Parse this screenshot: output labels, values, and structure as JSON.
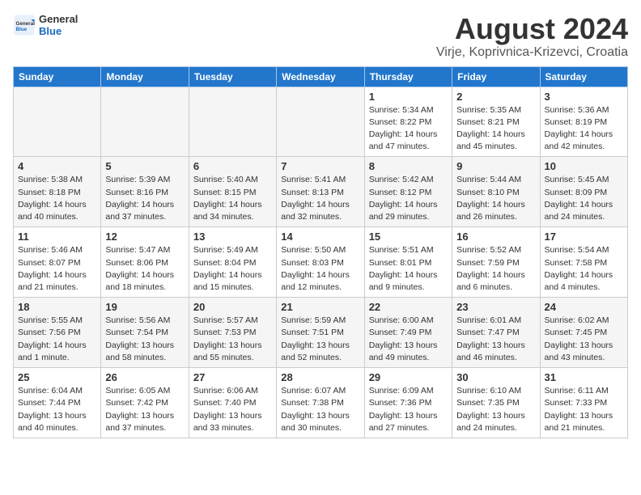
{
  "header": {
    "logo_line1": "General",
    "logo_line2": "Blue",
    "title": "August 2024",
    "subtitle": "Virje, Koprivnica-Krizevci, Croatia"
  },
  "weekdays": [
    "Sunday",
    "Monday",
    "Tuesday",
    "Wednesday",
    "Thursday",
    "Friday",
    "Saturday"
  ],
  "weeks": [
    [
      {
        "day": "",
        "info": ""
      },
      {
        "day": "",
        "info": ""
      },
      {
        "day": "",
        "info": ""
      },
      {
        "day": "",
        "info": ""
      },
      {
        "day": "1",
        "info": "Sunrise: 5:34 AM\nSunset: 8:22 PM\nDaylight: 14 hours\nand 47 minutes."
      },
      {
        "day": "2",
        "info": "Sunrise: 5:35 AM\nSunset: 8:21 PM\nDaylight: 14 hours\nand 45 minutes."
      },
      {
        "day": "3",
        "info": "Sunrise: 5:36 AM\nSunset: 8:19 PM\nDaylight: 14 hours\nand 42 minutes."
      }
    ],
    [
      {
        "day": "4",
        "info": "Sunrise: 5:38 AM\nSunset: 8:18 PM\nDaylight: 14 hours\nand 40 minutes."
      },
      {
        "day": "5",
        "info": "Sunrise: 5:39 AM\nSunset: 8:16 PM\nDaylight: 14 hours\nand 37 minutes."
      },
      {
        "day": "6",
        "info": "Sunrise: 5:40 AM\nSunset: 8:15 PM\nDaylight: 14 hours\nand 34 minutes."
      },
      {
        "day": "7",
        "info": "Sunrise: 5:41 AM\nSunset: 8:13 PM\nDaylight: 14 hours\nand 32 minutes."
      },
      {
        "day": "8",
        "info": "Sunrise: 5:42 AM\nSunset: 8:12 PM\nDaylight: 14 hours\nand 29 minutes."
      },
      {
        "day": "9",
        "info": "Sunrise: 5:44 AM\nSunset: 8:10 PM\nDaylight: 14 hours\nand 26 minutes."
      },
      {
        "day": "10",
        "info": "Sunrise: 5:45 AM\nSunset: 8:09 PM\nDaylight: 14 hours\nand 24 minutes."
      }
    ],
    [
      {
        "day": "11",
        "info": "Sunrise: 5:46 AM\nSunset: 8:07 PM\nDaylight: 14 hours\nand 21 minutes."
      },
      {
        "day": "12",
        "info": "Sunrise: 5:47 AM\nSunset: 8:06 PM\nDaylight: 14 hours\nand 18 minutes."
      },
      {
        "day": "13",
        "info": "Sunrise: 5:49 AM\nSunset: 8:04 PM\nDaylight: 14 hours\nand 15 minutes."
      },
      {
        "day": "14",
        "info": "Sunrise: 5:50 AM\nSunset: 8:03 PM\nDaylight: 14 hours\nand 12 minutes."
      },
      {
        "day": "15",
        "info": "Sunrise: 5:51 AM\nSunset: 8:01 PM\nDaylight: 14 hours\nand 9 minutes."
      },
      {
        "day": "16",
        "info": "Sunrise: 5:52 AM\nSunset: 7:59 PM\nDaylight: 14 hours\nand 6 minutes."
      },
      {
        "day": "17",
        "info": "Sunrise: 5:54 AM\nSunset: 7:58 PM\nDaylight: 14 hours\nand 4 minutes."
      }
    ],
    [
      {
        "day": "18",
        "info": "Sunrise: 5:55 AM\nSunset: 7:56 PM\nDaylight: 14 hours\nand 1 minute."
      },
      {
        "day": "19",
        "info": "Sunrise: 5:56 AM\nSunset: 7:54 PM\nDaylight: 13 hours\nand 58 minutes."
      },
      {
        "day": "20",
        "info": "Sunrise: 5:57 AM\nSunset: 7:53 PM\nDaylight: 13 hours\nand 55 minutes."
      },
      {
        "day": "21",
        "info": "Sunrise: 5:59 AM\nSunset: 7:51 PM\nDaylight: 13 hours\nand 52 minutes."
      },
      {
        "day": "22",
        "info": "Sunrise: 6:00 AM\nSunset: 7:49 PM\nDaylight: 13 hours\nand 49 minutes."
      },
      {
        "day": "23",
        "info": "Sunrise: 6:01 AM\nSunset: 7:47 PM\nDaylight: 13 hours\nand 46 minutes."
      },
      {
        "day": "24",
        "info": "Sunrise: 6:02 AM\nSunset: 7:45 PM\nDaylight: 13 hours\nand 43 minutes."
      }
    ],
    [
      {
        "day": "25",
        "info": "Sunrise: 6:04 AM\nSunset: 7:44 PM\nDaylight: 13 hours\nand 40 minutes."
      },
      {
        "day": "26",
        "info": "Sunrise: 6:05 AM\nSunset: 7:42 PM\nDaylight: 13 hours\nand 37 minutes."
      },
      {
        "day": "27",
        "info": "Sunrise: 6:06 AM\nSunset: 7:40 PM\nDaylight: 13 hours\nand 33 minutes."
      },
      {
        "day": "28",
        "info": "Sunrise: 6:07 AM\nSunset: 7:38 PM\nDaylight: 13 hours\nand 30 minutes."
      },
      {
        "day": "29",
        "info": "Sunrise: 6:09 AM\nSunset: 7:36 PM\nDaylight: 13 hours\nand 27 minutes."
      },
      {
        "day": "30",
        "info": "Sunrise: 6:10 AM\nSunset: 7:35 PM\nDaylight: 13 hours\nand 24 minutes."
      },
      {
        "day": "31",
        "info": "Sunrise: 6:11 AM\nSunset: 7:33 PM\nDaylight: 13 hours\nand 21 minutes."
      }
    ]
  ]
}
